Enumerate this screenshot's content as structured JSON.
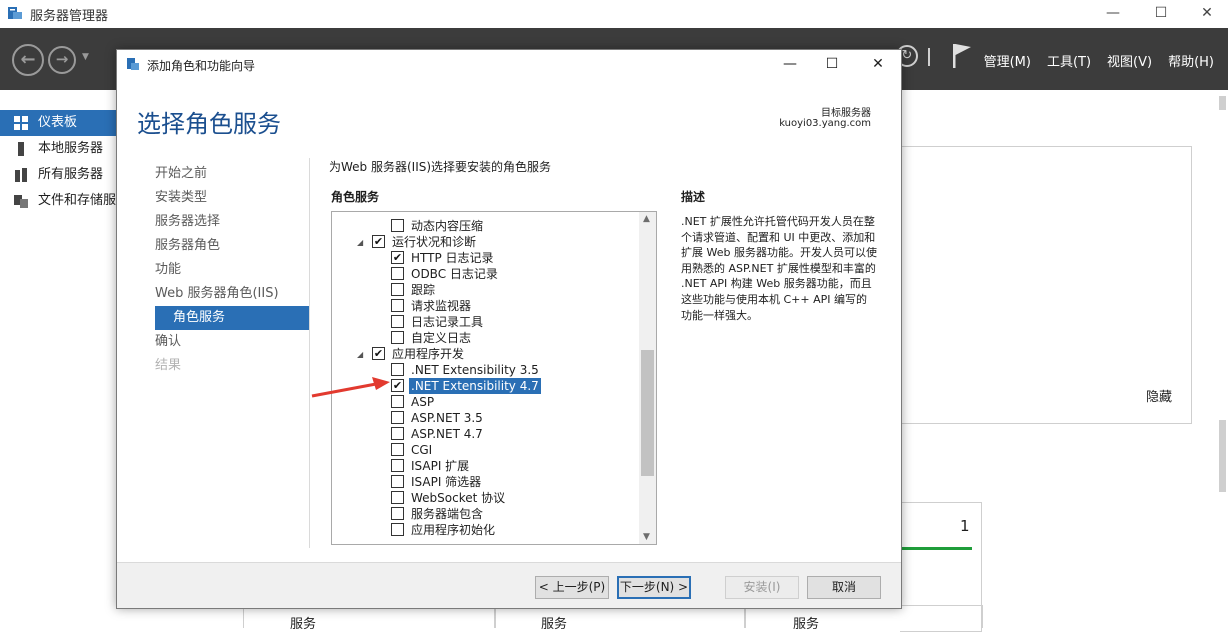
{
  "server_manager": {
    "title": "服务器管理器",
    "window_controls": {
      "minimize": "—",
      "maximize": "☐",
      "close": "✕"
    },
    "menu": [
      "管理(M)",
      "工具(T)",
      "视图(V)",
      "帮助(H)"
    ],
    "sidebar": [
      {
        "label": "仪表板",
        "active": true
      },
      {
        "label": "本地服务器",
        "active": false
      },
      {
        "label": "所有服务器",
        "active": false
      },
      {
        "label": "文件和存储服",
        "active": false
      }
    ],
    "hide_link": "隐藏",
    "tile_count": "1",
    "bottom_labels": [
      "服务",
      "服务",
      "服务"
    ]
  },
  "wizard": {
    "title": "添加角色和功能向导",
    "window_controls": {
      "minimize": "—",
      "maximize": "☐",
      "close": "✕"
    },
    "heading": "选择角色服务",
    "target_label": "目标服务器",
    "target_server": "kuoyi03.yang.com",
    "steps": [
      {
        "label": "开始之前",
        "state": "normal"
      },
      {
        "label": "安装类型",
        "state": "normal"
      },
      {
        "label": "服务器选择",
        "state": "normal"
      },
      {
        "label": "服务器角色",
        "state": "normal"
      },
      {
        "label": "功能",
        "state": "normal"
      },
      {
        "label": "Web 服务器角色(IIS)",
        "state": "normal"
      },
      {
        "label": "角色服务",
        "state": "current"
      },
      {
        "label": "确认",
        "state": "normal"
      },
      {
        "label": "结果",
        "state": "disabled"
      }
    ],
    "instruction": "为Web 服务器(IIS)选择要安装的角色服务",
    "roles_label": "角色服务",
    "description_label": "描述",
    "description": ".NET 扩展性允许托管代码开发人员在整个请求管道、配置和 UI 中更改、添加和扩展 Web 服务器功能。开发人员可以使用熟悉的 ASP.NET 扩展性模型和丰富的 .NET API 构建 Web 服务器功能，而且这些功能与使用本机 C++ API 编写的功能一样强大。",
    "tree": [
      {
        "label": "动态内容压缩",
        "level": 2,
        "checked": false
      },
      {
        "label": "运行状况和诊断",
        "level": 1,
        "checked": true,
        "expander": "◢"
      },
      {
        "label": "HTTP 日志记录",
        "level": 2,
        "checked": true
      },
      {
        "label": "ODBC 日志记录",
        "level": 2,
        "checked": false
      },
      {
        "label": "跟踪",
        "level": 2,
        "checked": false
      },
      {
        "label": "请求监视器",
        "level": 2,
        "checked": false
      },
      {
        "label": "日志记录工具",
        "level": 2,
        "checked": false
      },
      {
        "label": "自定义日志",
        "level": 2,
        "checked": false
      },
      {
        "label": "应用程序开发",
        "level": 1,
        "checked": true,
        "expander": "◢"
      },
      {
        "label": ".NET Extensibility 3.5",
        "level": 2,
        "checked": false
      },
      {
        "label": ".NET Extensibility 4.7",
        "level": 2,
        "checked": true,
        "selected": true
      },
      {
        "label": "ASP",
        "level": 2,
        "checked": false
      },
      {
        "label": "ASP.NET 3.5",
        "level": 2,
        "checked": false
      },
      {
        "label": "ASP.NET 4.7",
        "level": 2,
        "checked": false
      },
      {
        "label": "CGI",
        "level": 2,
        "checked": false
      },
      {
        "label": "ISAPI 扩展",
        "level": 2,
        "checked": false
      },
      {
        "label": "ISAPI 筛选器",
        "level": 2,
        "checked": false
      },
      {
        "label": "WebSocket 协议",
        "level": 2,
        "checked": false
      },
      {
        "label": "服务器端包含",
        "level": 2,
        "checked": false
      },
      {
        "label": "应用程序初始化",
        "level": 2,
        "checked": false
      }
    ],
    "buttons": {
      "previous": "< 上一步(P)",
      "next": "下一步(N) >",
      "install": "安装(I)",
      "cancel": "取消"
    }
  },
  "colors": {
    "accent": "#2a6fb5",
    "heading": "#1b4f8f",
    "toolbar": "#3c3c3c",
    "annotation_arrow": "#e23a2f",
    "tile_bar": "#1f9d3a"
  }
}
